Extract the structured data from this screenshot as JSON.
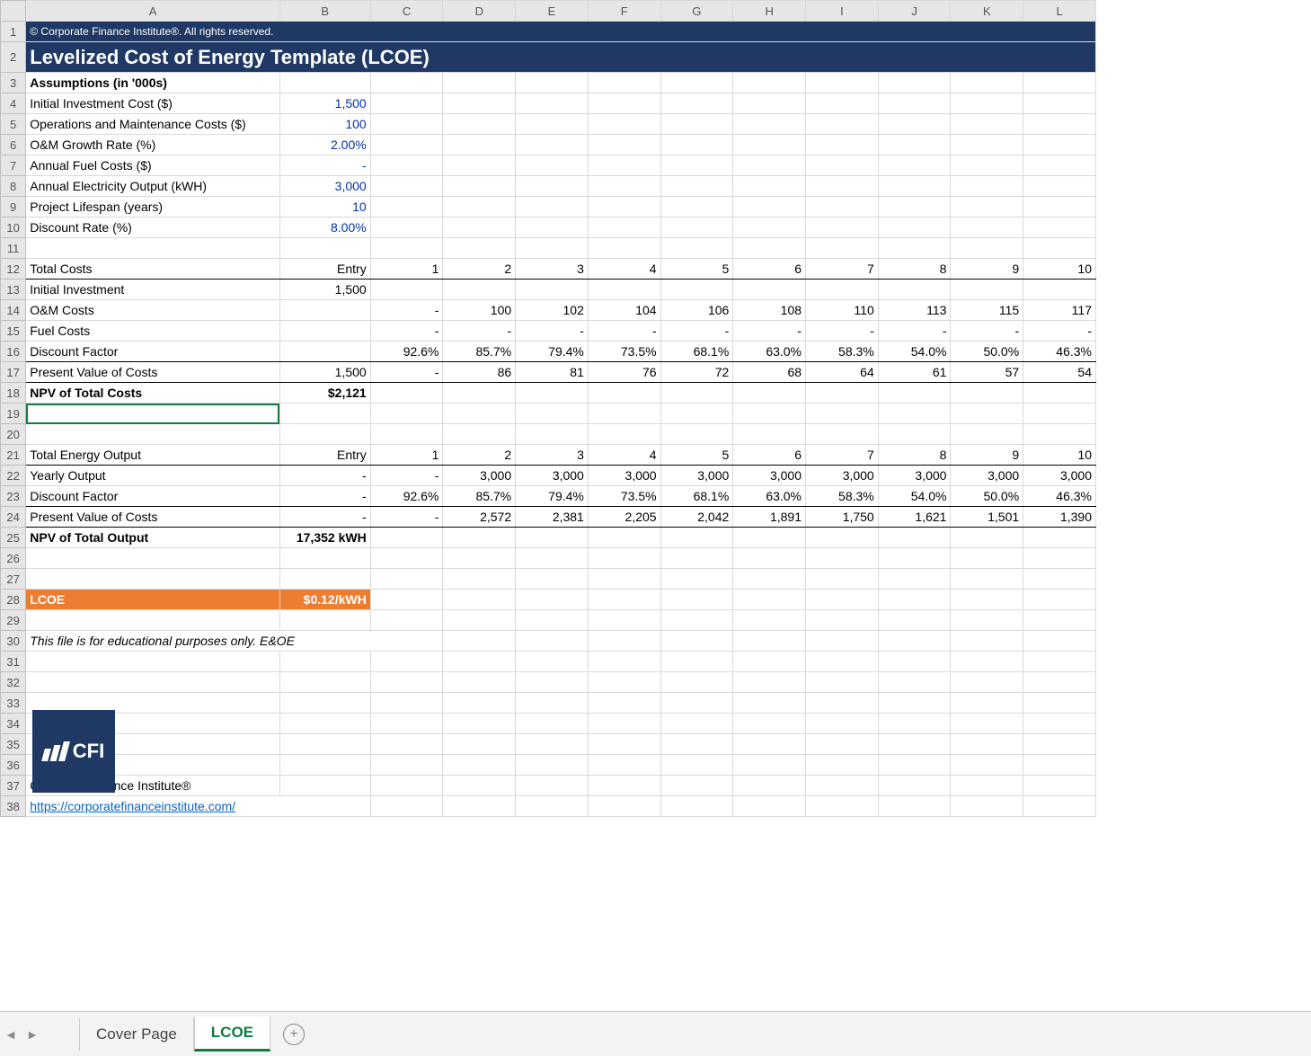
{
  "columns": [
    "A",
    "B",
    "C",
    "D",
    "E",
    "F",
    "G",
    "H",
    "I",
    "J",
    "K",
    "L"
  ],
  "row_numbers": [
    "1",
    "2",
    "3",
    "4",
    "5",
    "6",
    "7",
    "8",
    "9",
    "10",
    "11",
    "12",
    "13",
    "14",
    "15",
    "16",
    "17",
    "18",
    "19",
    "20",
    "21",
    "22",
    "23",
    "24",
    "25",
    "26",
    "27",
    "28",
    "29",
    "30",
    "31",
    "32",
    "33",
    "34",
    "35",
    "36",
    "37",
    "38"
  ],
  "copyright": "© Corporate Finance Institute®. All rights reserved.",
  "title": "Levelized Cost of Energy Template (LCOE)",
  "assumptions_header": "Assumptions (in '000s)",
  "assumptions": [
    {
      "label": "Initial Investment Cost ($)",
      "value": "1,500"
    },
    {
      "label": "Operations and Maintenance Costs ($)",
      "value": "100"
    },
    {
      "label": "O&M Growth Rate (%)",
      "value": "2.00%"
    },
    {
      "label": "Annual Fuel Costs ($)",
      "value": "-"
    },
    {
      "label": "Annual Electricity Output (kWH)",
      "value": "3,000"
    },
    {
      "label": "Project Lifespan (years)",
      "value": "10"
    },
    {
      "label": "Discount Rate (%)",
      "value": "8.00%"
    }
  ],
  "total_costs": {
    "header_label": "Total Costs",
    "entry_label": "Entry",
    "periods": [
      "1",
      "2",
      "3",
      "4",
      "5",
      "6",
      "7",
      "8",
      "9",
      "10"
    ],
    "rows": [
      {
        "label": "Initial Investment",
        "entry": "1,500",
        "vals": [
          "",
          "",
          "",
          "",
          "",
          "",
          "",
          "",
          "",
          ""
        ]
      },
      {
        "label": "O&M Costs",
        "entry": "",
        "vals": [
          "-",
          "100",
          "102",
          "104",
          "106",
          "108",
          "110",
          "113",
          "115",
          "117"
        ]
      },
      {
        "label": "Fuel Costs",
        "entry": "",
        "vals": [
          "-",
          "-",
          "-",
          "-",
          "-",
          "-",
          "-",
          "-",
          "-",
          "-"
        ]
      },
      {
        "label": "Discount Factor",
        "entry": "",
        "vals": [
          "92.6%",
          "85.7%",
          "79.4%",
          "73.5%",
          "68.1%",
          "63.0%",
          "58.3%",
          "54.0%",
          "50.0%",
          "46.3%"
        ]
      },
      {
        "label": "Present Value of Costs",
        "entry": "1,500",
        "vals": [
          "-",
          "86",
          "81",
          "76",
          "72",
          "68",
          "64",
          "61",
          "57",
          "54"
        ]
      }
    ],
    "npv_label": "NPV of Total Costs",
    "npv_value": "$2,121"
  },
  "total_output": {
    "header_label": "Total Energy Output",
    "entry_label": "Entry",
    "periods": [
      "1",
      "2",
      "3",
      "4",
      "5",
      "6",
      "7",
      "8",
      "9",
      "10"
    ],
    "rows": [
      {
        "label": "Yearly Output",
        "entry": "-",
        "vals": [
          "-",
          "3,000",
          "3,000",
          "3,000",
          "3,000",
          "3,000",
          "3,000",
          "3,000",
          "3,000",
          "3,000"
        ]
      },
      {
        "label": "Discount Factor",
        "entry": "-",
        "vals": [
          "92.6%",
          "85.7%",
          "79.4%",
          "73.5%",
          "68.1%",
          "63.0%",
          "58.3%",
          "54.0%",
          "50.0%",
          "46.3%"
        ]
      },
      {
        "label": "Present Value of Costs",
        "entry": "-",
        "vals": [
          "-",
          "2,572",
          "2,381",
          "2,205",
          "2,042",
          "1,891",
          "1,750",
          "1,621",
          "1,501",
          "1,390"
        ]
      }
    ],
    "npv_label": "NPV of Total Output",
    "npv_value": "17,352 kWH"
  },
  "lcoe": {
    "label": "LCOE",
    "value": "$0.12/kWH"
  },
  "disclaimer": "This file is for educational purposes only. E&OE",
  "logo_text": "CFI",
  "org_name": "Corporate Finance Institute®",
  "org_link": "https://corporatefinanceinstitute.com/",
  "tabs": {
    "inactive": "Cover Page",
    "active": "LCOE"
  },
  "nav": {
    "prev": "◄",
    "next": "►",
    "add": "+"
  },
  "colors": {
    "navy": "#1f3864",
    "orange": "#ed7d31",
    "link": "#0563c1",
    "input_blue": "#0033aa",
    "select_green": "#107c41"
  }
}
